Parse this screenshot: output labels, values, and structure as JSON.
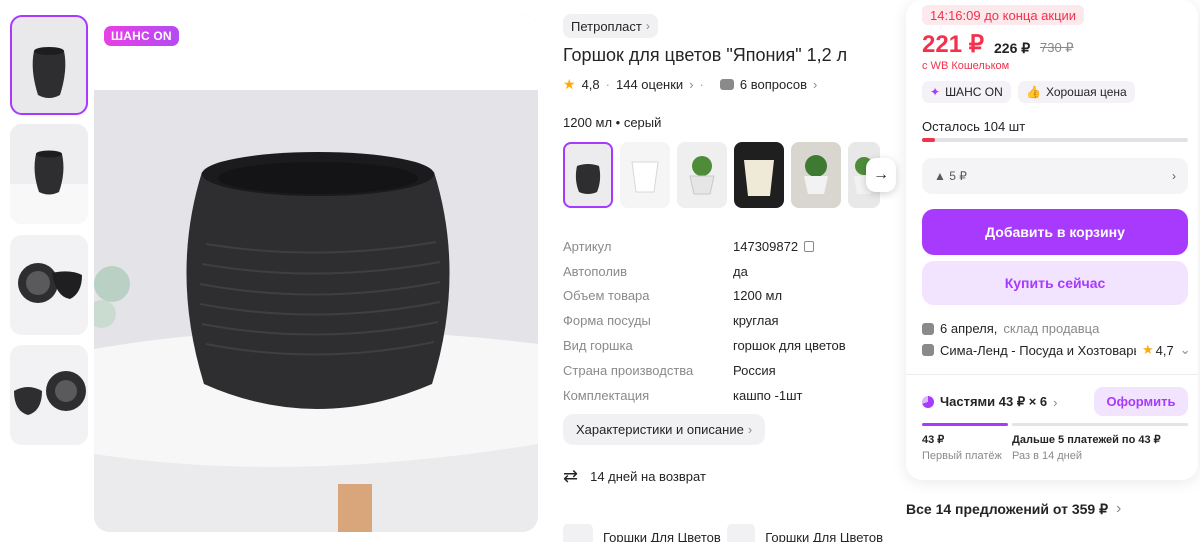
{
  "badge": "ШАНС ON",
  "brand": "Петропласт",
  "title": "Горшок для цветов \"Япония\" 1,2 л",
  "rating": {
    "value": "4,8",
    "reviews": "144 оценки",
    "questions": "6 вопросов"
  },
  "variant": "1200 мл • серый",
  "specs": [
    {
      "k": "Артикул",
      "v": "147309872"
    },
    {
      "k": "Автополив",
      "v": "да"
    },
    {
      "k": "Объем товара",
      "v": "1200 мл"
    },
    {
      "k": "Форма посуды",
      "v": "круглая"
    },
    {
      "k": "Вид горшка",
      "v": "горшок для цветов"
    },
    {
      "k": "Страна производства",
      "v": "Россия"
    },
    {
      "k": "Комплектация",
      "v": "кашпо -1шт"
    }
  ],
  "desc_button": "Характеристики и описание",
  "return_text": "14 дней на возврат",
  "categories": [
    "Горшки Для Цветов",
    "Горшки Для Цветов"
  ],
  "buy": {
    "timer": "14:16:09 до конца акции",
    "price_now": "221 ₽",
    "price_regular": "226 ₽",
    "price_old": "730 ₽",
    "wallet": "с WB Кошельком",
    "pill_chance": "ШАНС ON",
    "pill_good": "Хорошая цена",
    "stock": "Осталось 104 шт",
    "stock_fraction": 0.05,
    "coupon": "5 ₽",
    "add_to_cart": "Добавить в корзину",
    "buy_now": "Купить сейчас",
    "delivery_date": "6 апреля,",
    "delivery_from": "склад продавца",
    "seller": "Сима-Ленд - Посуда и Хозтовары",
    "seller_rating": "4,7",
    "installments": "Частями 43 ₽ × 6",
    "order_button": "Оформить",
    "first_amount": "43 ₽",
    "first_note": "Первый платёж",
    "rest_amount": "Дальше 5 платежей по 43 ₽",
    "rest_note": "Раз в 14 дней"
  },
  "offers": "Все 14 предложений от 359 ₽",
  "colors": {
    "accent": "#a73afd",
    "price_red": "#f2314c",
    "star": "#ffa90a",
    "pot": "#2e2e30"
  }
}
